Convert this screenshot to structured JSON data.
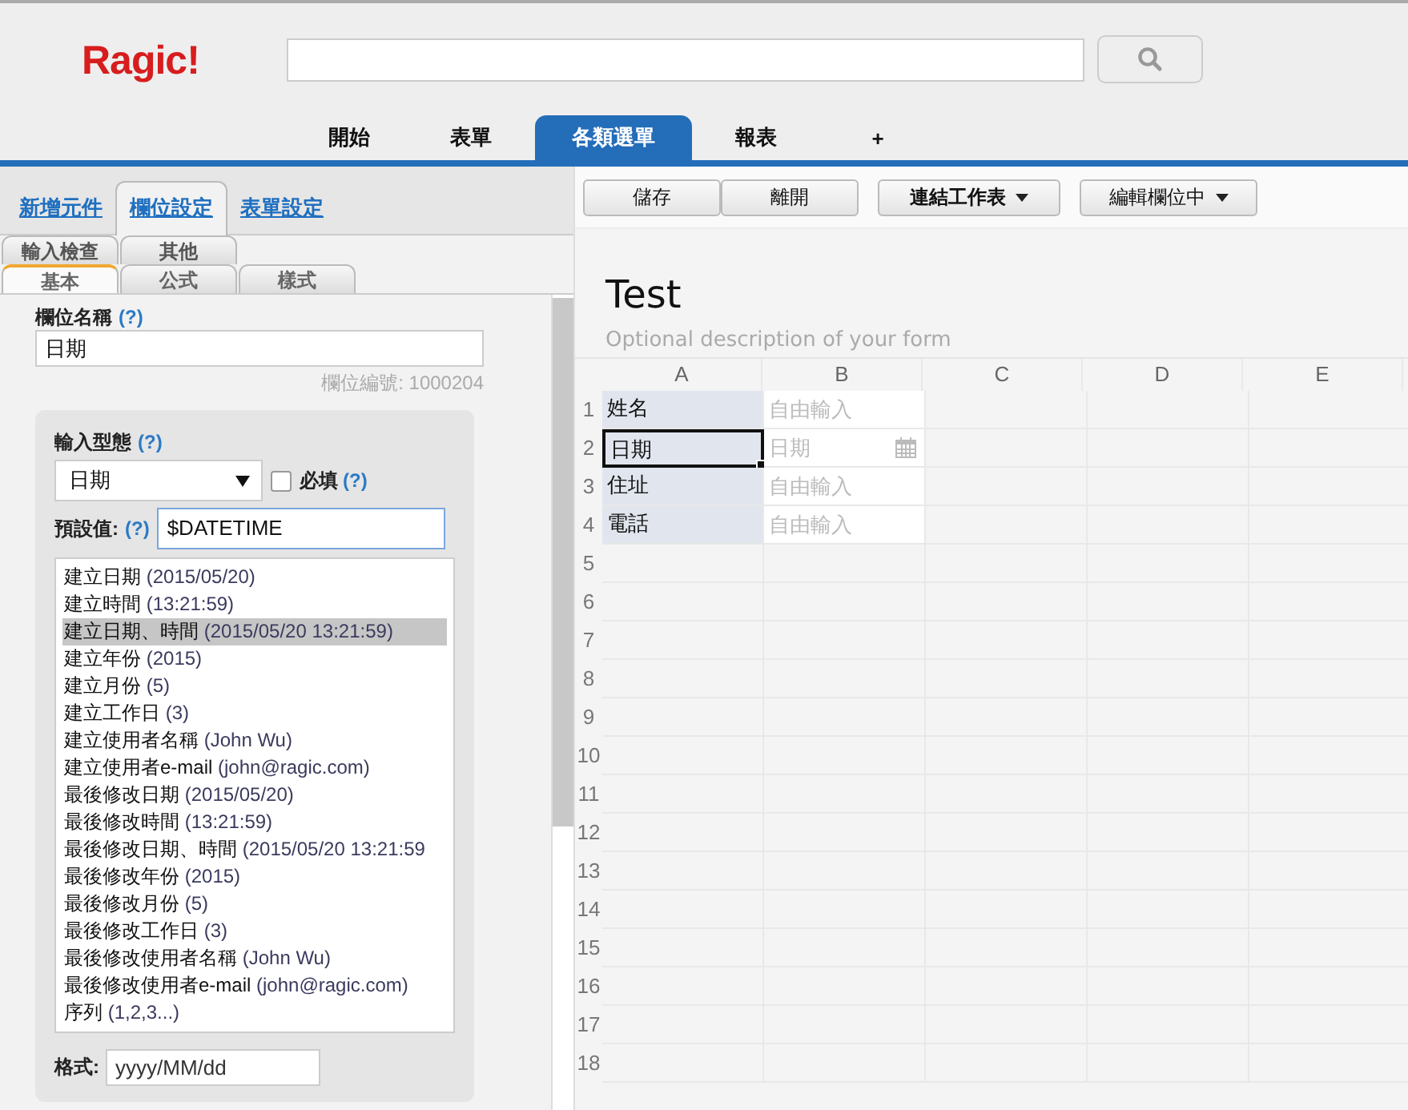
{
  "header": {
    "logo": "Ragic!"
  },
  "nav_tabs": [
    {
      "label": "開始",
      "selected": false
    },
    {
      "label": "表單",
      "selected": false
    },
    {
      "label": "各類選單",
      "selected": true
    },
    {
      "label": "報表",
      "selected": false
    },
    {
      "label": "+",
      "selected": false
    }
  ],
  "left_panel": {
    "tabs": [
      {
        "label": "新增元件",
        "selected": false
      },
      {
        "label": "欄位設定",
        "selected": true
      },
      {
        "label": "表單設定",
        "selected": false
      }
    ],
    "subtabs_row1": [
      {
        "label": "輸入檢查",
        "selected": false
      },
      {
        "label": "其他",
        "selected": false
      }
    ],
    "subtabs_row2": [
      {
        "label": "基本",
        "selected": true
      },
      {
        "label": "公式",
        "selected": false
      },
      {
        "label": "樣式",
        "selected": false
      }
    ],
    "field_name": {
      "label": "欄位名稱",
      "help": "(?)",
      "value": "日期"
    },
    "field_id": "欄位編號: 1000204",
    "input_type": {
      "label": "輸入型態",
      "help": "(?)",
      "value": "日期"
    },
    "required": {
      "label": "必填",
      "help": "(?)",
      "checked": false
    },
    "default_value": {
      "label": "預設值:",
      "help": "(?)",
      "value": "$DATETIME"
    },
    "presets": [
      {
        "label": "建立日期",
        "value": "(2015/05/20)",
        "selected": false
      },
      {
        "label": "建立時間",
        "value": "(13:21:59)",
        "selected": false
      },
      {
        "label": "建立日期、時間",
        "value": "(2015/05/20 13:21:59)",
        "selected": true
      },
      {
        "label": "建立年份",
        "value": "(2015)",
        "selected": false
      },
      {
        "label": "建立月份",
        "value": "(5)",
        "selected": false
      },
      {
        "label": "建立工作日",
        "value": "(3)",
        "selected": false
      },
      {
        "label": "建立使用者名稱",
        "value": "(John Wu)",
        "selected": false
      },
      {
        "label": "建立使用者e-mail",
        "value": "(john@ragic.com)",
        "selected": false
      },
      {
        "label": "最後修改日期",
        "value": "(2015/05/20)",
        "selected": false
      },
      {
        "label": "最後修改時間",
        "value": "(13:21:59)",
        "selected": false
      },
      {
        "label": "最後修改日期、時間",
        "value": "(2015/05/20 13:21:59",
        "selected": false
      },
      {
        "label": "最後修改年份",
        "value": "(2015)",
        "selected": false
      },
      {
        "label": "最後修改月份",
        "value": "(5)",
        "selected": false
      },
      {
        "label": "最後修改工作日",
        "value": "(3)",
        "selected": false
      },
      {
        "label": "最後修改使用者名稱",
        "value": "(John Wu)",
        "selected": false
      },
      {
        "label": "最後修改使用者e-mail",
        "value": "(john@ragic.com)",
        "selected": false
      },
      {
        "label": "序列",
        "value": "(1,2,3...)",
        "selected": false
      }
    ],
    "format": {
      "label": "格式:",
      "value": "yyyy/MM/dd"
    }
  },
  "toolbar": [
    {
      "label": "儲存",
      "dropdown": false
    },
    {
      "label": "離開",
      "dropdown": false
    },
    {
      "label": "連結工作表",
      "dropdown": true
    },
    {
      "label": "編輯欄位中",
      "dropdown": true
    }
  ],
  "form": {
    "title": "Test",
    "description_placeholder": "Optional description of your form"
  },
  "sheet": {
    "columns": [
      "A",
      "B",
      "C",
      "D",
      "E"
    ],
    "rows": [
      {
        "number": "1",
        "cells": [
          {
            "kind": "label",
            "text": "姓名",
            "selected": false
          },
          {
            "kind": "text",
            "placeholder": "自由輸入",
            "selected": false
          }
        ]
      },
      {
        "number": "2",
        "cells": [
          {
            "kind": "label",
            "text": "日期",
            "selected": true
          },
          {
            "kind": "date",
            "placeholder": "日期",
            "selected": false
          }
        ]
      },
      {
        "number": "3",
        "cells": [
          {
            "kind": "label",
            "text": "住址",
            "selected": false
          },
          {
            "kind": "text",
            "placeholder": "自由輸入",
            "selected": false
          }
        ]
      },
      {
        "number": "4",
        "cells": [
          {
            "kind": "label",
            "text": "電話",
            "selected": false
          },
          {
            "kind": "text",
            "placeholder": "自由輸入",
            "selected": false
          }
        ]
      },
      {
        "number": "5",
        "cells": []
      },
      {
        "number": "6",
        "cells": []
      },
      {
        "number": "7",
        "cells": []
      },
      {
        "number": "8",
        "cells": []
      },
      {
        "number": "9",
        "cells": []
      },
      {
        "number": "10",
        "cells": []
      },
      {
        "number": "11",
        "cells": []
      },
      {
        "number": "12",
        "cells": []
      },
      {
        "number": "13",
        "cells": []
      },
      {
        "number": "14",
        "cells": []
      },
      {
        "number": "15",
        "cells": []
      },
      {
        "number": "16",
        "cells": []
      },
      {
        "number": "17",
        "cells": []
      },
      {
        "number": "18",
        "cells": []
      }
    ]
  }
}
